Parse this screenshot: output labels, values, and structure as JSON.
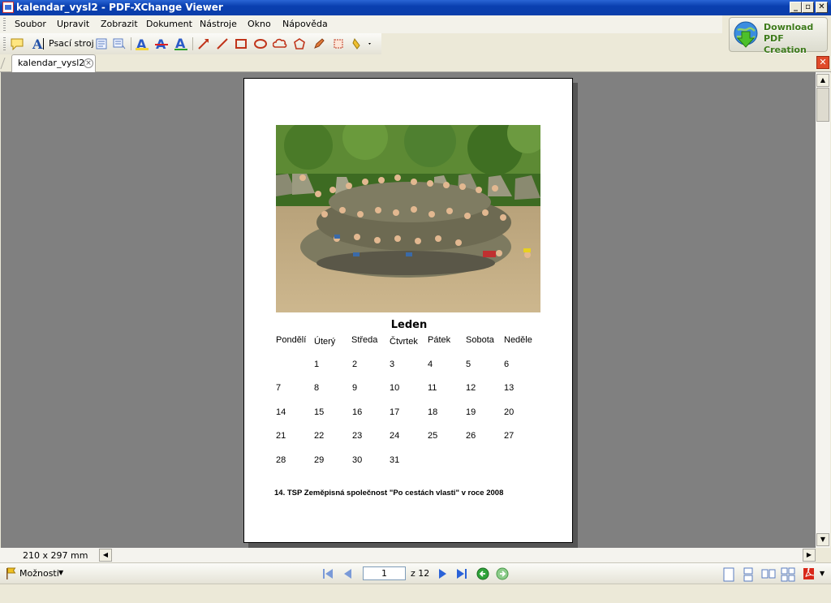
{
  "window": {
    "title": "kalendar_vysl2 - PDF-XChange Viewer"
  },
  "menu": [
    "Soubor",
    "Upravit",
    "Zobrazit",
    "Dokument",
    "Nástroje",
    "Okno",
    "Nápověda"
  ],
  "toolbar": {
    "typewriter_label": "Psací stroj"
  },
  "ad": {
    "line1": "Download PDF",
    "line2": "Creation Tools"
  },
  "tabs": [
    {
      "label": "kalendar_vysl2"
    }
  ],
  "document": {
    "month": "Leden",
    "weekdays": [
      "Pondělí",
      "Úterý",
      "Středa",
      "Čtvrtek",
      "Pátek",
      "Sobota",
      "Neděle"
    ],
    "weeks": [
      [
        "",
        "1",
        "2",
        "3",
        "4",
        "5",
        "6"
      ],
      [
        "7",
        "8",
        "9",
        "10",
        "11",
        "12",
        "13"
      ],
      [
        "14",
        "15",
        "16",
        "17",
        "18",
        "19",
        "20"
      ],
      [
        "21",
        "22",
        "23",
        "24",
        "25",
        "26",
        "27"
      ],
      [
        "28",
        "29",
        "30",
        "31",
        "",
        "",
        ""
      ]
    ],
    "footer": "14. TSP Zeměpisná společnost \"Po cestách vlasti\" v roce 2008"
  },
  "status": {
    "page_size": "210 x 297 mm",
    "options_label": "Možnosti",
    "current_page": "1",
    "page_total": "z 12"
  },
  "colors": {
    "titlebar": "#0a3fb0",
    "viewport_bg": "#808080",
    "nav_blue": "#2a62d8",
    "nav_green": "#2fa33a",
    "ad_text": "#3d7a1a"
  }
}
